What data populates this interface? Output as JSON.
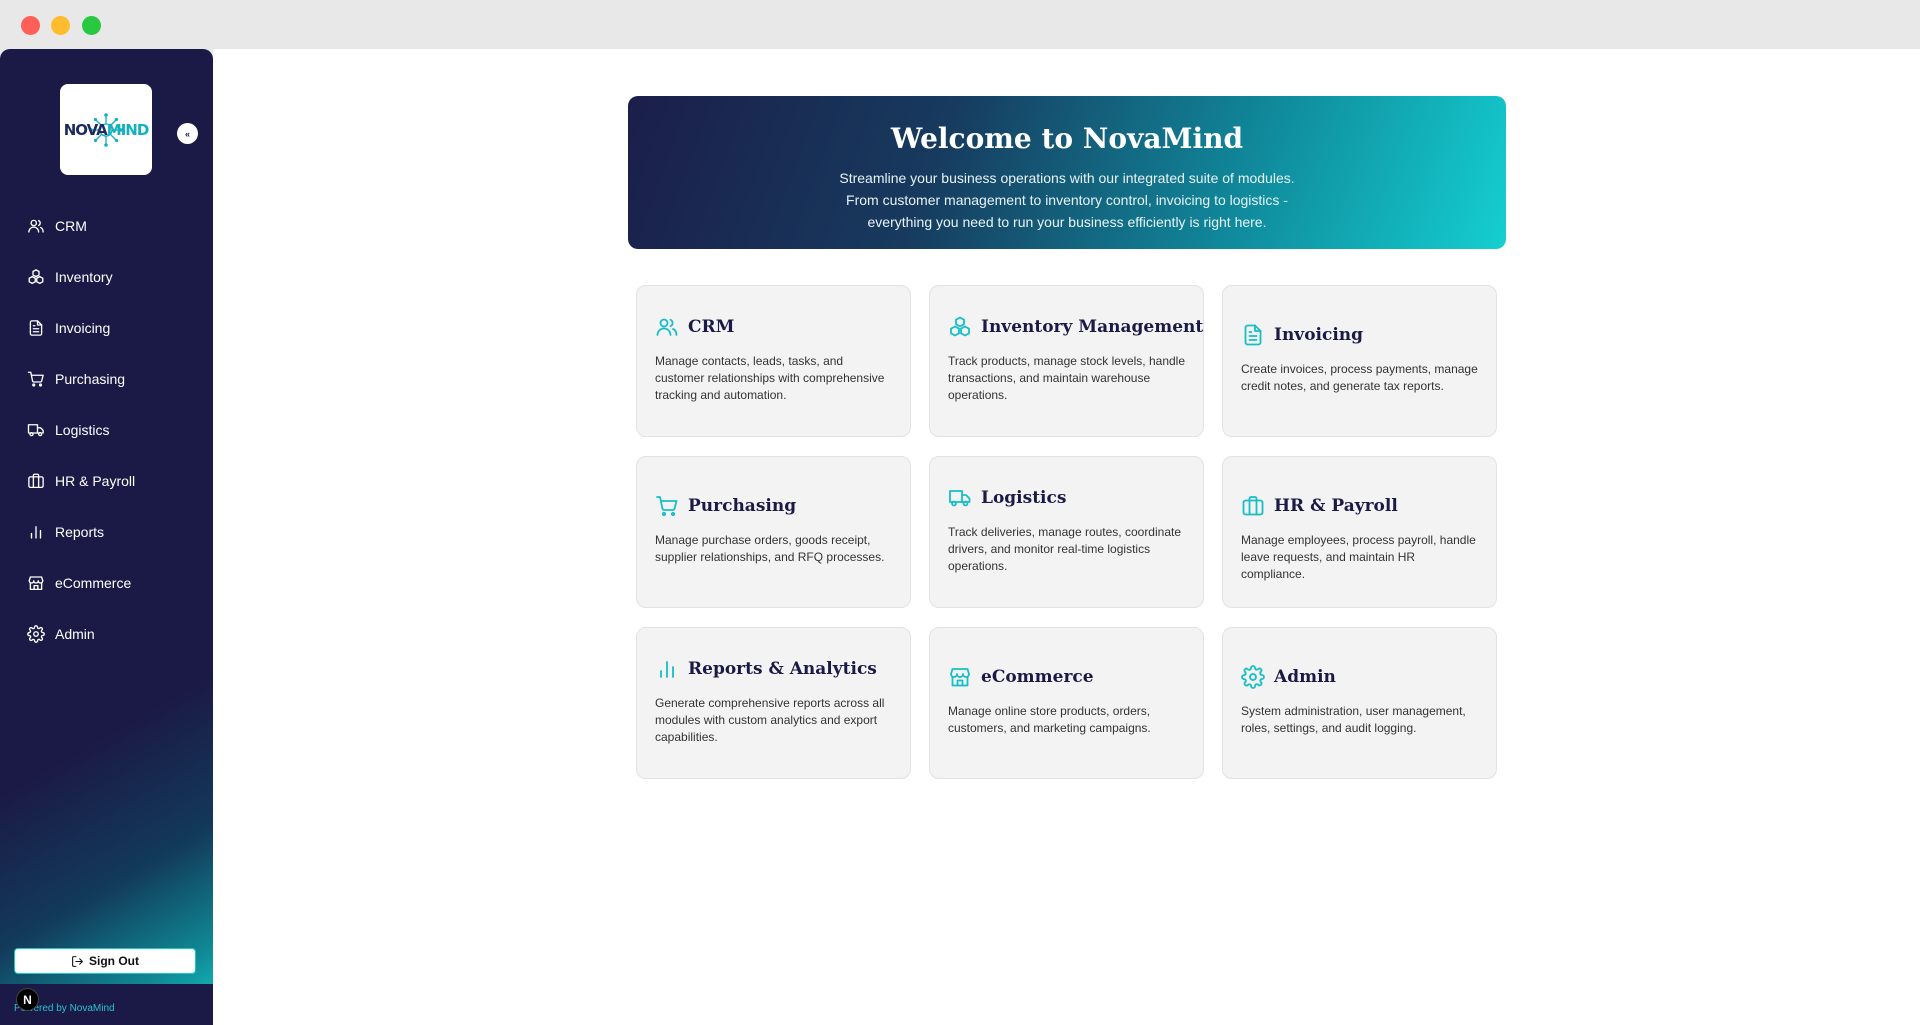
{
  "sidebar": {
    "logo": {
      "text_a": "NOVA",
      "text_b": "MIND"
    },
    "collapse_label": "«",
    "items": [
      {
        "label": "CRM",
        "icon": "users-icon"
      },
      {
        "label": "Inventory",
        "icon": "boxes-icon"
      },
      {
        "label": "Invoicing",
        "icon": "document-icon"
      },
      {
        "label": "Purchasing",
        "icon": "cart-icon"
      },
      {
        "label": "Logistics",
        "icon": "truck-icon"
      },
      {
        "label": "HR & Payroll",
        "icon": "briefcase-icon"
      },
      {
        "label": "Reports",
        "icon": "bar-chart-icon"
      },
      {
        "label": "eCommerce",
        "icon": "store-icon"
      },
      {
        "label": "Admin",
        "icon": "gear-icon"
      }
    ],
    "sign_out": "Sign Out",
    "powered_by": "Powered by NovaMind",
    "badge": "N"
  },
  "hero": {
    "title": "Welcome to NovaMind",
    "description": "Streamline your business operations with our integrated suite of modules. From customer management to inventory control, invoicing to logistics - everything you need to run your business efficiently is right here."
  },
  "modules": [
    {
      "title": "CRM",
      "icon": "users-icon",
      "description": "Manage contacts, leads, tasks, and customer relationships with comprehensive tracking and automation."
    },
    {
      "title": "Inventory Management",
      "icon": "boxes-icon",
      "description": "Track products, manage stock levels, handle transactions, and maintain warehouse operations."
    },
    {
      "title": "Invoicing",
      "icon": "document-icon",
      "description": "Create invoices, process payments, manage credit notes, and generate tax reports."
    },
    {
      "title": "Purchasing",
      "icon": "cart-icon",
      "description": "Manage purchase orders, goods receipt, supplier relationships, and RFQ processes."
    },
    {
      "title": "Logistics",
      "icon": "truck-icon",
      "description": "Track deliveries, manage routes, coordinate drivers, and monitor real-time logistics operations."
    },
    {
      "title": "HR & Payroll",
      "icon": "briefcase-icon",
      "description": "Manage employees, process payroll, handle leave requests, and maintain HR compliance."
    },
    {
      "title": "Reports & Analytics",
      "icon": "bar-chart-icon",
      "description": "Generate comprehensive reports across all modules with custom analytics and export capabilities."
    },
    {
      "title": "eCommerce",
      "icon": "store-icon",
      "description": "Manage online store products, orders, customers, and marketing campaigns."
    },
    {
      "title": "Admin",
      "icon": "gear-icon",
      "description": "System administration, user management, roles, settings, and audit logging."
    }
  ],
  "colors": {
    "sidebar": "#1b1a46",
    "accent": "#16bfc8",
    "hero_start": "#1b1e4a",
    "hero_end": "#14cfd0"
  }
}
